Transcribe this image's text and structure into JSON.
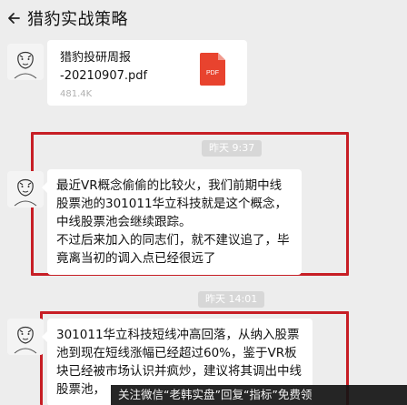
{
  "header": {
    "title": "猎豹实战策略",
    "back_icon": "back-arrow-icon"
  },
  "file_message": {
    "file_name": "猎豹投研周报\n-20210907.pdf",
    "file_size": "481.4K",
    "file_type_label": "PDF",
    "icon": "pdf-file-icon",
    "icon_color": "#e8432e"
  },
  "messages": [
    {
      "time": "昨天 9:37",
      "paragraphs": [
        "最近VR概念偷偷的比较火，我们前期中线股票池的301011华立科技就是这个概念，中线股票池会继续跟踪。",
        "不过后来加入的同志们，就不建议追了，毕竟离当初的调入点已经很远了"
      ]
    },
    {
      "time": "昨天 14:01",
      "paragraphs": [
        "301011华立科技短线冲高回落，从纳入股票池到现在短线涨幅已经超过60%，鉴于VR板块已经被市场认识并疯炒，建议将其调出中线股票池，"
      ]
    }
  ],
  "banner": {
    "text": "关注微信“老韩实盘”回复“指标”免费领"
  },
  "colors": {
    "background": "#ededed",
    "bubble": "#ffffff",
    "highlight_border": "#c71e25",
    "pdf_red": "#e8432e"
  }
}
